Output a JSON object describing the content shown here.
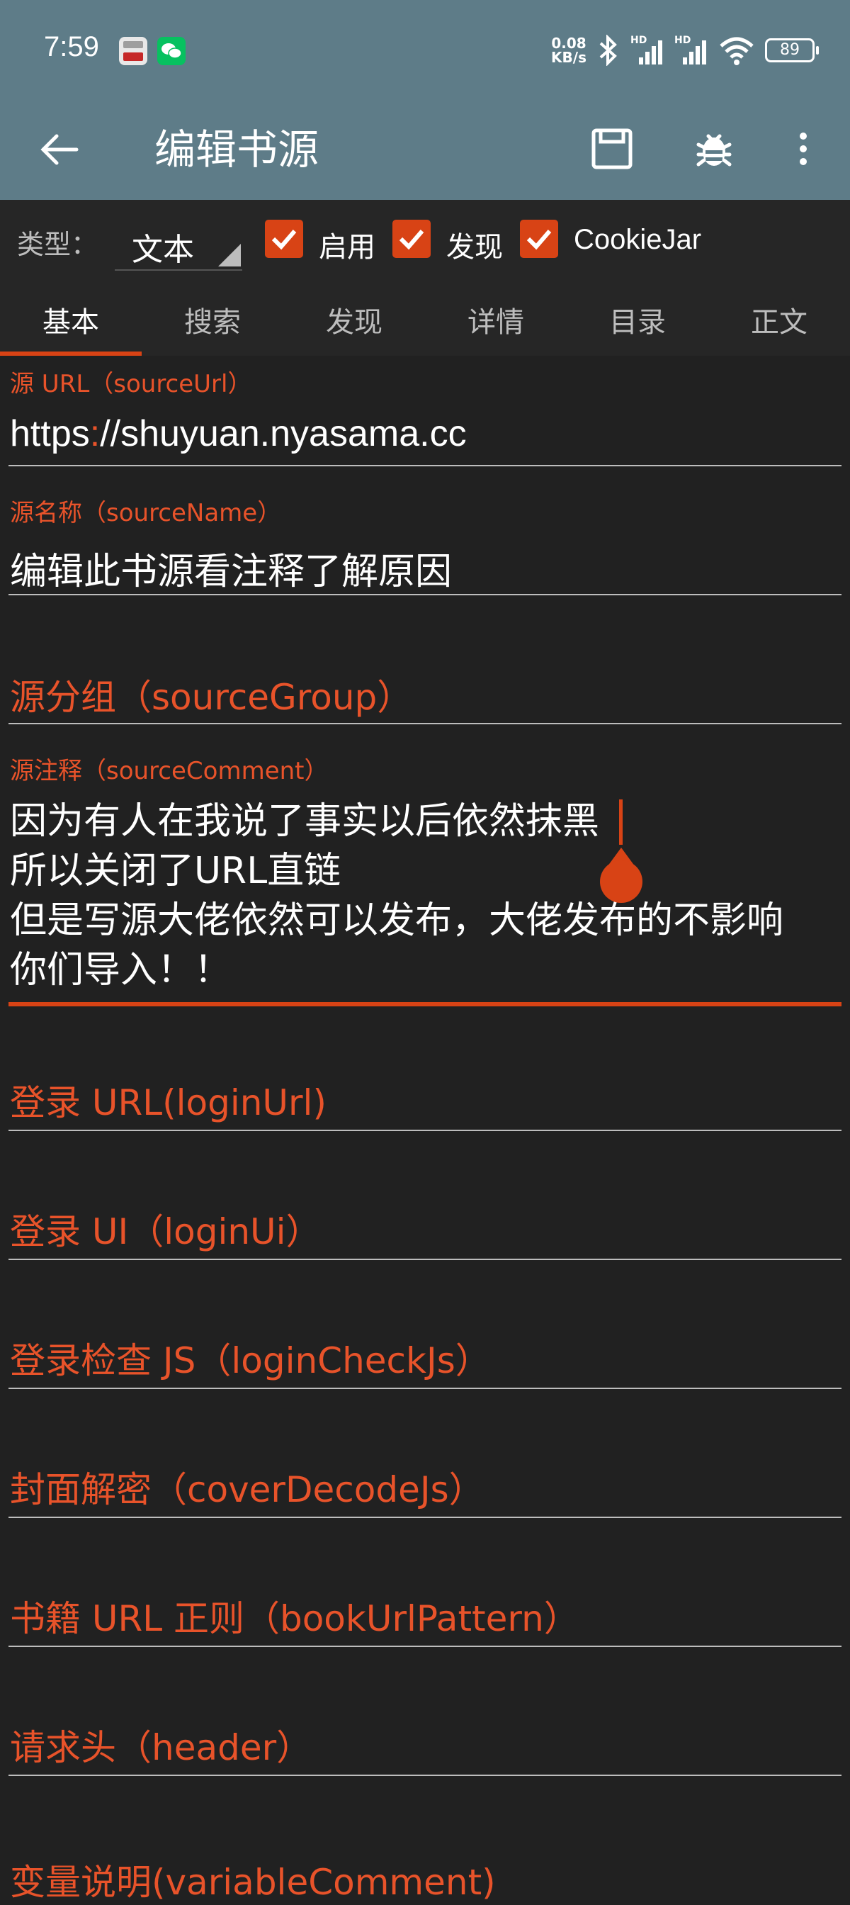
{
  "status_bar": {
    "time": "7:59",
    "net_speed_value": "0.08",
    "net_speed_unit": "KB/s",
    "battery": "89",
    "signal_1_label": "HD",
    "signal_2_label": "HD"
  },
  "toolbar": {
    "title": "编辑书源"
  },
  "type_row": {
    "label": "类型：",
    "selected_type": "文本",
    "enabled_label": "启用",
    "enabled_checked": true,
    "discover_label": "发现",
    "discover_checked": true,
    "cookiejar_label": "CookieJar",
    "cookiejar_checked": true
  },
  "tabs": [
    {
      "label": "基本",
      "active": true
    },
    {
      "label": "搜索",
      "active": false
    },
    {
      "label": "发现",
      "active": false
    },
    {
      "label": "详情",
      "active": false
    },
    {
      "label": "目录",
      "active": false
    },
    {
      "label": "正文",
      "active": false
    }
  ],
  "fields": {
    "source_url": {
      "label": "源 URL（sourceUrl）",
      "value_prefix": "https",
      "value_colon": ":",
      "value_rest": "//shuyuan.nyasama.cc"
    },
    "source_name": {
      "label": "源名称（sourceName）",
      "value": "编辑此书源看注释了解原因"
    },
    "source_group": {
      "hint": "源分组（sourceGroup）"
    },
    "source_comment": {
      "label": "源注释（sourceComment）",
      "lines": [
        "因为有人在我说了事实以后依然抹黑",
        "所以关闭了URL直链",
        "但是写源大佬依然可以发布，大佬发布的不影响",
        "你们导入！！"
      ]
    },
    "login_url": {
      "hint": "登录 URL(loginUrl)"
    },
    "login_ui": {
      "hint": "登录 UI（loginUi）"
    },
    "login_check_js": {
      "hint": "登录检查 JS（loginCheckJs）"
    },
    "cover_decode_js": {
      "hint": "封面解密（coverDecodeJs）"
    },
    "book_url_pattern": {
      "hint": "书籍 URL 正则（bookUrlPattern）"
    },
    "header": {
      "hint": "请求头（header）"
    },
    "variable_comment": {
      "hint": "变量说明(variableComment)"
    }
  },
  "colors": {
    "accent": "#d84315",
    "toolbar": "#5e7c88",
    "background": "#212121"
  },
  "icons": {
    "back": "arrow-left-icon",
    "save": "save-icon",
    "debug": "bug-icon",
    "more": "more-vert-icon"
  }
}
